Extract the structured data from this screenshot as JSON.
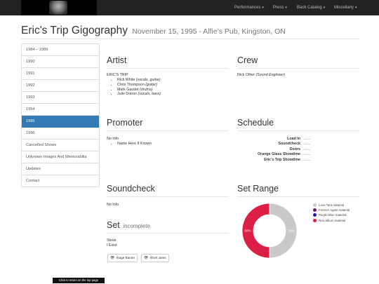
{
  "nav": {
    "items": [
      {
        "label": "Performances"
      },
      {
        "label": "Press"
      },
      {
        "label": "Back Catalog"
      },
      {
        "label": "Miscellany"
      }
    ]
  },
  "header": {
    "title": "Eric's Trip Gigography",
    "subtitle": "November 15, 1995 - Alfie's Pub, Kingston, ON"
  },
  "sidebar": {
    "items": [
      {
        "label": "1984 – 1989"
      },
      {
        "label": "1990"
      },
      {
        "label": "1991"
      },
      {
        "label": "1992"
      },
      {
        "label": "1993"
      },
      {
        "label": "1994"
      },
      {
        "label": "1995",
        "active": true
      },
      {
        "label": "1996"
      },
      {
        "label": "Cancelled Shows"
      },
      {
        "label": "Unknown Images And Memorabilia"
      },
      {
        "label": "Updates"
      },
      {
        "label": "Contact"
      }
    ]
  },
  "artist": {
    "heading": "Artist",
    "band": "ERIC'S TRIP",
    "members": [
      {
        "name": "Rick White",
        "role": "(vocals, guitar)"
      },
      {
        "name": "Chris Thompson",
        "role": "(guitar)"
      },
      {
        "name": "Mark Gaudet",
        "role": "(drums)"
      },
      {
        "name": "Julie Doiron",
        "role": "(vocals, bass)"
      }
    ]
  },
  "crew": {
    "heading": "Crew",
    "name": "Nick Other",
    "role": "(Sound Engineer)"
  },
  "promoter": {
    "heading": "Promoter",
    "info": "No Info",
    "item": "Name Here If Known"
  },
  "schedule": {
    "heading": "Schedule",
    "rows": [
      {
        "label": "Load In",
        "value": "...:..."
      },
      {
        "label": "Soundcheck",
        "value": "...:..."
      },
      {
        "label": "Doors",
        "value": "...:..."
      },
      {
        "label": "Orange Glass Showtime",
        "value": "...:..."
      },
      {
        "label": "Eric's Trip Showtime",
        "value": "...:..."
      }
    ]
  },
  "soundcheck": {
    "heading": "Soundcheck",
    "info": "No Info"
  },
  "setlist": {
    "heading": "Set",
    "status": "incomplete",
    "songs": [
      "Stove",
      "I Exist"
    ],
    "buttons": {
      "stage": "Stage Banter",
      "short": "Short Jams"
    }
  },
  "setrange": {
    "heading": "Set Range",
    "chart_data": {
      "type": "pie",
      "categories": [
        "Love Tara material",
        "Forever Again material",
        "Purple Blue material",
        "Non-album material"
      ],
      "values": [
        50,
        0,
        0,
        50
      ],
      "labels": [
        "50%",
        "",
        "",
        "50%"
      ],
      "colors": [
        "#c9c9c9",
        "#6a1b6a",
        "#1a1aa5",
        "#dc1f45"
      ]
    }
  },
  "footer": {
    "top_link": "Click to return on the top page"
  }
}
